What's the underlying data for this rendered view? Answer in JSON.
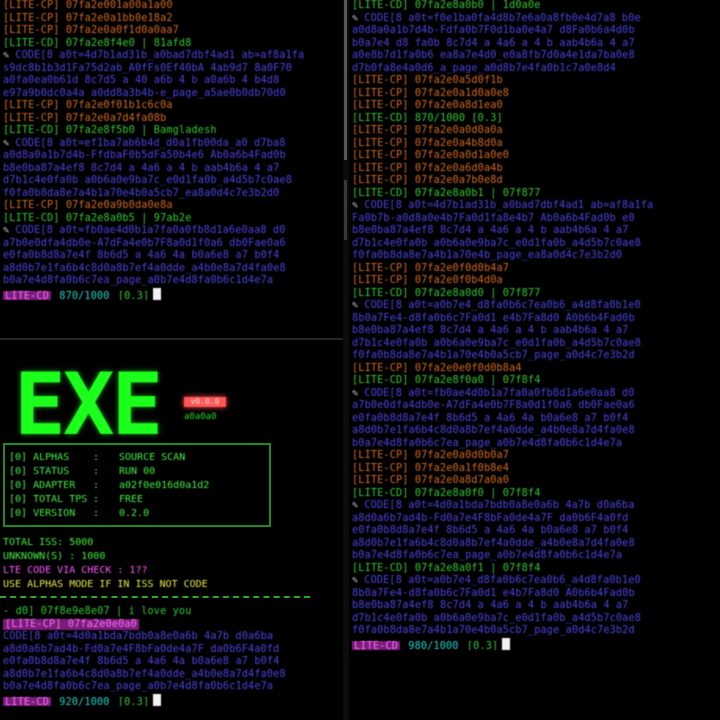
{
  "left_top_lines": [
    {
      "t": "[LITE-CP] 07fa2e001a00a1a00",
      "c": "c-orange"
    },
    {
      "t": "[LITE-CP] 07fa2e0a1bb0e18a2",
      "c": "c-orange"
    },
    {
      "t": "[LITE-CP] 07fa2e0a0f1d0a0aa7",
      "c": "c-orange"
    },
    {
      "t": "[LITE-CD] 07fa2e8f4e0 | 81afd8",
      "c": "c-green"
    },
    {
      "t": "CODE[8  a0t=4d7b1ad31b_a0bad7dbf4ad1 ab=af8a1fa",
      "c": "c-blue",
      "clip": true
    },
    {
      "t": "s9dc8b1b3d1Fa75d2ab_A0fFs0Ef40bA 4ab9d7 8a0F70",
      "c": "c-blue"
    },
    {
      "t": "a0fa0ea0b61d 8c7d5 a 40 a6b 4  b  a0a6b 4 b4d8",
      "c": "c-blue"
    },
    {
      "t": "e97a9b0dc0a4a a0dd8a3b4b-e_page_a5ae0b0db70d0",
      "c": "c-blue"
    },
    {
      "t": "[LITE-CP] 07fa2e0f01b1c6c0a",
      "c": "c-orange"
    },
    {
      "t": "[LITE-CP] 07fa2e0a7d4fa08b",
      "c": "c-orange"
    },
    {
      "t": "[LITE-CD] 07fa2e8f5b0 | Bamgladesh",
      "c": "c-green"
    },
    {
      "t": "CODE[8  a0t=ef1ba7ab6b4d_d0a1fb00da_a0 d7ba8",
      "c": "c-blue",
      "clip": true
    },
    {
      "t": "a0d8a0a1b7d4b-FfdbaF0b5dFa50b4e6 Ab0a6b4Fad0b",
      "c": "c-blue"
    },
    {
      "t": "b8e0ba87a4ef8 8c7d4 a 4a6 a 4 b  aab4b6a 4 a7",
      "c": "c-blue"
    },
    {
      "t": "d7b1c4e0fa0b a0b6a0e9ba7c_e0d1fa0b_a4d5b7c0ae8",
      "c": "c-blue"
    },
    {
      "t": "f0fa0b8da8e7a4b1a70e4b0a5cb7_ea8a0d4c7e3b2d0",
      "c": "c-blue"
    },
    {
      "t": "[LITE-CP] 07fa2e0a9b0da0e8a",
      "c": "c-orange"
    },
    {
      "t": "[LITE-CD] 07fa2e8a0b5 | 97ab2e",
      "c": "c-green"
    },
    {
      "t": "CODE[8  a0t=fb0ae4d0b1a7fa0a0fb8d1a6e0aa8 d0",
      "c": "c-blue",
      "clip": true
    },
    {
      "t": "a7b0e0dfa4db0e-A7dFa4e0b7F8a0d1f0a6 db0Fae0a6",
      "c": "c-blue"
    },
    {
      "t": "e0fa0b8d8a7e4f 8b6d5 a 4a6 4a b0a6e8 a7 b0f4",
      "c": "c-blue"
    },
    {
      "t": "a8d0b7e1fa6b4c8d0a8b7ef4a0dde_a4b0e8a7d4fa0e8",
      "c": "c-blue"
    },
    {
      "t": "b0a7e4d8fa0b6c7ea_page_a0b7e4d8fa0b6c1d4e7a",
      "c": "c-blue"
    }
  ],
  "left_top_prompt": {
    "label": "LITE-CD",
    "progress": "870/1000",
    "rate": "[0.3]"
  },
  "exe": {
    "logo": "EXE",
    "tag": "v0.0.0",
    "sub": "a0a0a0",
    "info": [
      {
        "k": "[0] ALPHAS",
        "v": "SOURCE SCAN"
      },
      {
        "k": "[0] STATUS",
        "v": "RUN 00"
      },
      {
        "k": "[0] ADAPTER",
        "v": "a02f0e016d0a1d2"
      },
      {
        "k": "[0] TOTAL TPS",
        "v": "FREE"
      },
      {
        "k": "[0] VERSION",
        "v": "0.2.0"
      }
    ],
    "stats": [
      {
        "t": "TOTAL ISS: 5000",
        "c": ""
      },
      {
        "t": "UNKNOWN(S) : 1000",
        "c": ""
      },
      {
        "t": "LTE CODE VIA CHECK : 1??",
        "c": "mag"
      },
      {
        "t": "USE ALPHAS MODE IF IN ISS NOT CODE",
        "c": "yel"
      }
    ]
  },
  "left_bottom_lines": [
    {
      "t": "- d0] 07f8e9e8e07 | i love you",
      "c": "c-green"
    },
    {
      "t": "[LITE-CP] 07fa2e0e0a0",
      "c": "c-orange",
      "hl": "magenta"
    },
    {
      "t": "CODE[8  a0t=4d0a1bda7bdb0a8e0a6b 4a7b d0a6ba",
      "c": "c-blue"
    },
    {
      "t": "a8d0a6b7ad4b-Fd0a7e4F8bFa0de4a7F da0b6F4a0fd",
      "c": "c-blue"
    },
    {
      "t": "e0fa0b8d8a7e4f 8b6d5 a 4a6 4a b0a6e8 a7 b0f4",
      "c": "c-blue"
    },
    {
      "t": "a8d0b7e1fa6b4c8d0a8b7ef4a0dde_a4b0e8a7d4fa0e8",
      "c": "c-blue"
    },
    {
      "t": "b0a7e4d8fa0b6c7ea_page_a0b7e4d8fa0b6c1d4e7a",
      "c": "c-blue"
    }
  ],
  "left_bottom_prompt": {
    "label": "LITE-CD",
    "progress": "920/1000",
    "rate": "[0.3]"
  },
  "right_lines": [
    {
      "t": "[LITE-CD] 07fa2e8a0b0 | 1d0a0e",
      "c": "c-green"
    },
    {
      "t": "CODE[8  a0t=f0e1ba0fa4d8b7e6a0a8fb0e4d7a8 b0e",
      "c": "c-blue",
      "clip": true
    },
    {
      "t": "a0d8a0a1b7d4b-Fdfa0b7F0d1ba0e4a7 d8Fa0b6a4d0b",
      "c": "c-blue"
    },
    {
      "t": "b0a7e4 d8 fa0b 8c7d4 a 4a6 a 4 b  aab4b6a 4 a7",
      "c": "c-blue"
    },
    {
      "t": "a0e8b7d1fa0b6 ea8a7e4d0_e0a8fb7d0a4e1da7ba0e8",
      "c": "c-blue"
    },
    {
      "t": "d7b0fa8e4a0d6_a_page_a0d8b7e4fa0b1c7a0e8d4",
      "c": "c-blue"
    },
    {
      "t": "[LITE-CP] 07fa2e0a5d0f1b",
      "c": "c-orange"
    },
    {
      "t": "[LITE-CP] 07fa2e0a1d0a0e8",
      "c": "c-orange"
    },
    {
      "t": "[LITE-CP] 07fa2e0a8d1ea0",
      "c": "c-orange"
    },
    {
      "t": "[LITE-CD] 870/1000 [0.3]",
      "c": "c-green",
      "hl": "progress"
    },
    {
      "t": "[LITE-CP] 07fa2e0a0d0a0a",
      "c": "c-orange"
    },
    {
      "t": "[LITE-CP] 07fa2e0a4b8d0a",
      "c": "c-orange"
    },
    {
      "t": "[LITE-CP] 07fa2e0a0d1a0e0",
      "c": "c-orange"
    },
    {
      "t": "[LITE-CP] 07fa2e0a6d0a4b",
      "c": "c-orange"
    },
    {
      "t": "[LITE-CP] 07fa2e0a7b0e8d",
      "c": "c-orange"
    },
    {
      "t": "[LITE-CD] 07fa2e8a0b1 | 07f877",
      "c": "c-green"
    },
    {
      "t": "CODE[8  a0t=4d7b1ad31b_a0bad7dbf4ad1 ab=af8a1fa",
      "c": "c-blue",
      "clip": true
    },
    {
      "t": "Fa0b7b-a0d8a0e4b7Fa0d1fa8e4b7 Ab0a6b4Fad0b e0",
      "c": "c-blue"
    },
    {
      "t": "b8e0ba87a4ef8 8c7d4 a 4a6 a 4 b  aab4b6a 4 a7",
      "c": "c-blue"
    },
    {
      "t": "d7b1c4e0fa0b a0b6a0e9ba7c_e0d1fa0b_a4d5b7c0ae8",
      "c": "c-blue"
    },
    {
      "t": "f0fa0b8da8e7a4b1a70e4b_page_ea8a0d4c7e3b2d0",
      "c": "c-blue"
    },
    {
      "t": "[LITE-CP] 07fa2e0f0d0b4a7",
      "c": "c-orange"
    },
    {
      "t": "[LITE-CP] 07fa2e0f0b4d0a",
      "c": "c-orange"
    },
    {
      "t": "[LITE-CD] 07fa2e8a0d0 | 07f877",
      "c": "c-green"
    },
    {
      "t": "CODE[8  a0t=a0b7e4_d8fa0b6c7ea0b6_a4d8fa0b1e0",
      "c": "c-blue",
      "clip": true
    },
    {
      "t": "8b0a7Fe4-d8fa0b6c7Fa0d1 e4b7Fa8d0 A0b6b4Fad0b",
      "c": "c-blue"
    },
    {
      "t": "b8e0ba87a4ef8 8c7d4 a 4a6 a 4 b  aab4b6a 4 a7",
      "c": "c-blue"
    },
    {
      "t": "d7b1c4e0fa0b a0b6a0e9ba7c_e0d1fa0b_a4d5b7c0ae8",
      "c": "c-blue"
    },
    {
      "t": "f0fa0b8da8e7a4b1a70e4b0a5cb7_page_a0d4c7e3b2d",
      "c": "c-blue"
    },
    {
      "t": "[LITE-CP] 07fa2e0e0f0d0b8a4",
      "c": "c-orange"
    },
    {
      "t": "[LITE-CD] 07fa2e8f0a0 | 07f8f4",
      "c": "c-green"
    },
    {
      "t": "CODE[8  a0t=fb0ae4d0b1a7fa0a0fb8d1a6e0aa8 d0",
      "c": "c-blue",
      "clip": true
    },
    {
      "t": "a7b0e0dfa4db0e-A7dFa4e0b7F8a0d1f0a6 db0Fae0a6",
      "c": "c-blue"
    },
    {
      "t": "e0fa0b8d8a7e4f 8b6d5 a 4a6 4a b0a6e8 a7 b0f4",
      "c": "c-blue"
    },
    {
      "t": "a8d0b7e1fa6b4c8d0a8b7ef4a0dde_a4b0e8a7d4fa0e8",
      "c": "c-blue"
    },
    {
      "t": "b0a7e4d8fa0b6c7ea_page_a0b7e4d8fa0b6c1d4e7a",
      "c": "c-blue"
    },
    {
      "t": "[LITE-CP] 07fa2e0a0d0b0a7",
      "c": "c-orange"
    },
    {
      "t": "[LITE-CP] 07fa2e0a1f0b8e4",
      "c": "c-orange"
    },
    {
      "t": "[LITE-CP] 07fa2e0a8d7a0a0",
      "c": "c-orange"
    },
    {
      "t": "[LITE-CD] 07fa2e8a0f0 | 07f8f4",
      "c": "c-green"
    },
    {
      "t": "CODE[8  a0t=4d0a1bda7bdb0a8e0a6b 4a7b d0a6ba",
      "c": "c-blue",
      "clip": true
    },
    {
      "t": "a8d0a6b7ad4b-Fd0a7e4F8bFa0de4a7F da0b6F4a0fd",
      "c": "c-blue"
    },
    {
      "t": "e0fa0b8d8a7e4f 8b6d5 a 4a6 4a b0a6e8 a7 b0f4",
      "c": "c-blue"
    },
    {
      "t": "a8d0b7e1fa6b4c8d0a8b7ef4a0dde_a4b0e8a7d4fa0e8",
      "c": "c-blue"
    },
    {
      "t": "b0a7e4d8fa0b6c7ea_page_a0b7e4d8fa0b6c1d4e7a",
      "c": "c-blue"
    },
    {
      "t": "[LITE-CD] 07fa2e8a0f1 | 07f8f4",
      "c": "c-green"
    },
    {
      "t": "CODE[8  a0t=a0b7e4_d8fa0b6c7ea0b6_a4d8fa0b1e0",
      "c": "c-blue",
      "clip": true
    },
    {
      "t": "8b0a7Fe4-d8fa0b6c7Fa0d1 e4b7Fa8d0 A0b6b4Fad0b",
      "c": "c-blue"
    },
    {
      "t": "b8e0ba87a4ef8 8c7d4 a 4a6 a 4 b  aab4b6a 4 a7",
      "c": "c-blue"
    },
    {
      "t": "d7b1c4e0fa0b a0b6a0e9ba7c_e0d1fa0b_a4d5b7c0ae8",
      "c": "c-blue"
    },
    {
      "t": "f0fa0b8da8e7a4b1a70e4b0a5cb7_page_a0d4c7e3b2d",
      "c": "c-blue"
    }
  ],
  "right_prompt": {
    "label": "LITE-CD",
    "progress": "980/1000",
    "rate": "[0.3]"
  },
  "colors": {
    "bg": "#000000",
    "green": "#22ff22",
    "orange": "#d2691e",
    "blue": "#4b43dd",
    "magenta": "#ff55ff"
  }
}
